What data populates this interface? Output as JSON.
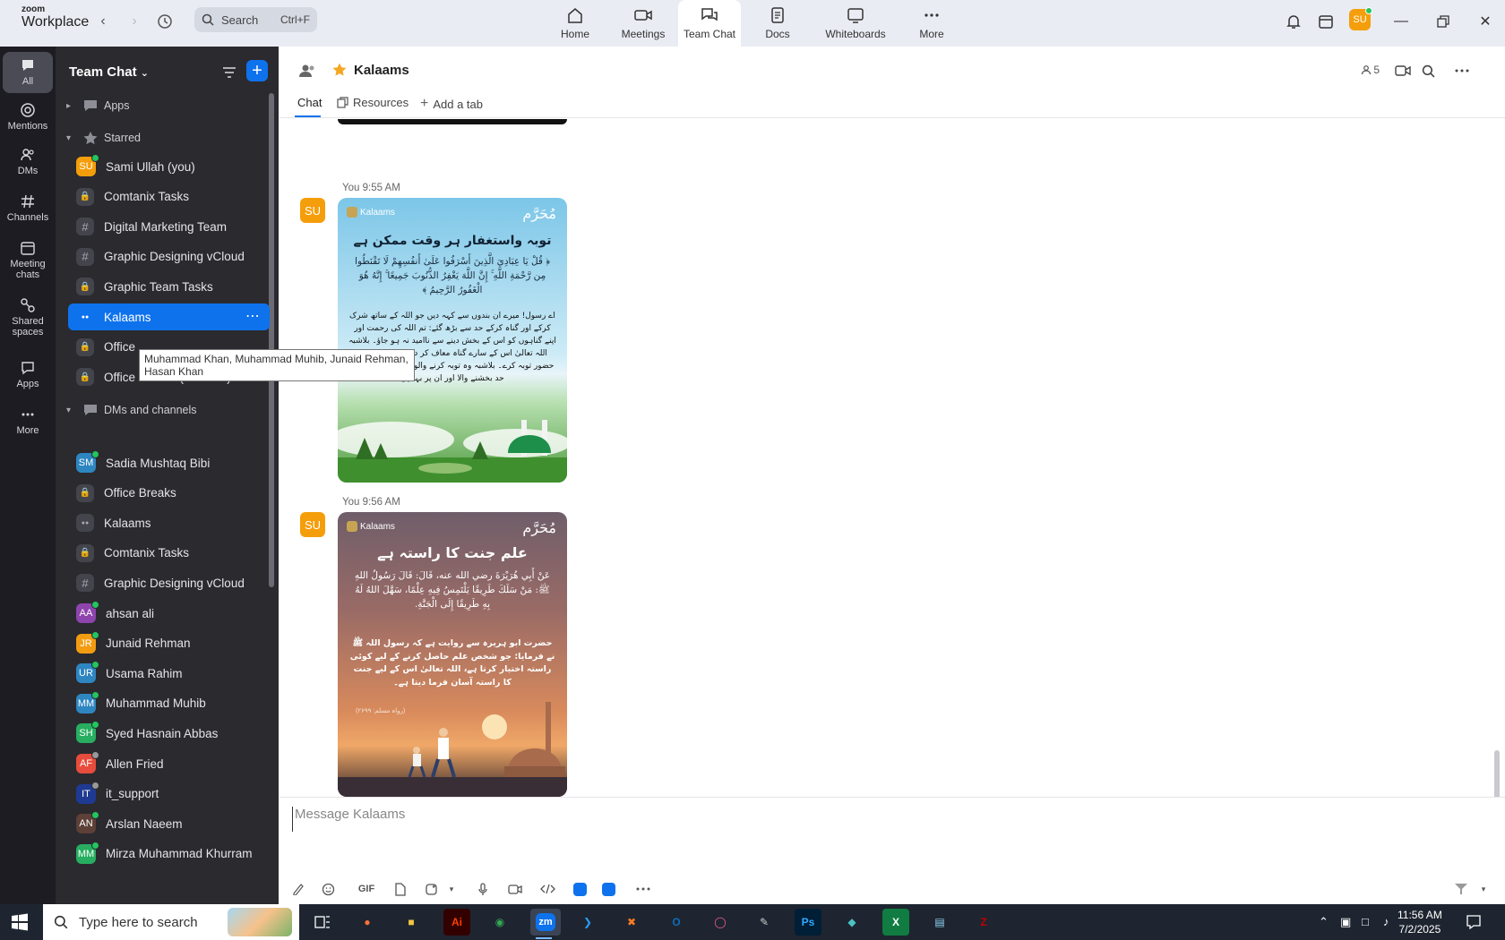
{
  "app": {
    "brand_top": "zoom",
    "brand_bottom": "Workplace"
  },
  "titlebar": {
    "search_placeholder": "Search",
    "search_shortcut": "Ctrl+F",
    "nav": [
      {
        "label": "Home",
        "icon": "home-icon"
      },
      {
        "label": "Meetings",
        "icon": "video-icon"
      },
      {
        "label": "Team Chat",
        "icon": "chat-icon",
        "active": true
      },
      {
        "label": "Docs",
        "icon": "doc-icon"
      },
      {
        "label": "Whiteboards",
        "icon": "whiteboard-icon"
      },
      {
        "label": "More",
        "icon": "more-icon"
      }
    ],
    "user_initials": "SU"
  },
  "rail": [
    {
      "label": "All",
      "icon": "chat-bubble-icon",
      "active": true
    },
    {
      "label": "Mentions",
      "icon": "at-icon"
    },
    {
      "label": "DMs",
      "icon": "people-icon"
    },
    {
      "label": "Channels",
      "icon": "hash-icon"
    },
    {
      "label": "Meeting chats",
      "icon": "calendar-icon"
    },
    {
      "label": "Shared spaces",
      "icon": "shared-icon"
    },
    {
      "label": "Apps",
      "icon": "apps-icon"
    },
    {
      "label": "More",
      "icon": "ellipsis-icon"
    }
  ],
  "sidebar": {
    "title": "Team Chat",
    "sections": {
      "apps": "Apps",
      "starred": "Starred",
      "dms": "DMs and channels"
    },
    "starred": [
      {
        "label": "Sami Ullah (you)",
        "kind": "avatar",
        "initials": "SU",
        "color": "#f59e0b",
        "status": "#22c55e"
      },
      {
        "label": "Comtanix Tasks",
        "kind": "lock"
      },
      {
        "label": "Digital Marketing Team",
        "kind": "hash"
      },
      {
        "label": "Graphic Designing vCloud",
        "kind": "hash"
      },
      {
        "label": "Graphic Team Tasks",
        "kind": "lock"
      },
      {
        "label": "Kalaams",
        "kind": "group",
        "active": true
      },
      {
        "label": "Office",
        "kind": "lock"
      },
      {
        "label": "Office Breaks (IT Team)",
        "kind": "lock",
        "trail": true
      }
    ],
    "dms": [
      {
        "label": "Sadia Mushtaq Bibi",
        "kind": "avatar",
        "initials": "SM",
        "color": "#2e86c1",
        "status": "#22c55e"
      },
      {
        "label": "Office Breaks",
        "kind": "lock"
      },
      {
        "label": "Kalaams",
        "kind": "group"
      },
      {
        "label": "Comtanix Tasks",
        "kind": "lock"
      },
      {
        "label": "Graphic Designing vCloud",
        "kind": "hash"
      },
      {
        "label": "ahsan ali",
        "kind": "avatar",
        "initials": "AA",
        "color": "#8e44ad",
        "status": "#22c55e"
      },
      {
        "label": "Junaid Rehman",
        "kind": "avatar",
        "initials": "JR",
        "color": "#f39c12",
        "status": "#22c55e"
      },
      {
        "label": "Usama Rahim",
        "kind": "avatar",
        "initials": "UR",
        "color": "#2e86c1",
        "status": "#22c55e"
      },
      {
        "label": "Muhammad Muhib",
        "kind": "avatar",
        "initials": "MM",
        "color": "#2e86c1",
        "status": "#22c55e"
      },
      {
        "label": "Syed Hasnain Abbas",
        "kind": "avatar",
        "initials": "SH",
        "color": "#27ae60",
        "status": "#22c55e"
      },
      {
        "label": "Allen Fried",
        "kind": "avatar",
        "initials": "AF",
        "color": "#e74c3c",
        "status": "#999999"
      },
      {
        "label": "it_support",
        "kind": "avatar",
        "initials": "IT",
        "color": "#1f3a93",
        "status": "#999999"
      },
      {
        "label": "Arslan Naeem",
        "kind": "avatar",
        "initials": "AN",
        "color": "#5d4037",
        "status": "#22c55e"
      },
      {
        "label": "Mirza Muhammad Khurram",
        "kind": "avatar",
        "initials": "MM",
        "color": "#27ae60",
        "status": "#22c55e"
      }
    ],
    "tooltip": "Muhammad Khan, Muhammad Muhib, Junaid Rehman, Hasan Khan"
  },
  "channel": {
    "title": "Kalaams",
    "member_count": "5",
    "tabs": {
      "chat": "Chat",
      "resources": "Resources",
      "add": "Add a tab"
    }
  },
  "messages": [
    {
      "sender_initials": "SU",
      "meta": "You 9:55 AM",
      "card": {
        "brand": "Kalaams",
        "badge": "مُحَرَّم",
        "heading": "توبہ واستغفار ہر وقت ممکن ہے",
        "arabic": "﴿ قُلْ يَا عِبَادِيَ الَّذِينَ أَسْرَفُوا عَلَىٰ أَنفُسِهِمْ لَا تَقْنَطُوا مِن رَّحْمَةِ اللَّهِ ۚ إِنَّ اللَّهَ يَغْفِرُ الذُّنُوبَ جَمِيعًا ۚ إِنَّهُ هُوَ الْغَفُورُ الرَّحِيمُ ﴾",
        "urdu": "اے رسول! میرے ان بندوں سے کہہ دیں جو اللہ کے ساتھ شرک کرکے اور گناہ کرکے حد سے بڑھ گئے: تم اللہ کی رحمت اور اپنے گناہوں کو اس کے بخش دینے سے ناامید نہ ہو جاؤ۔ بلاشبہ اللہ تعالیٰ اس کے سارے گناہ معاف کر دیتا ہے جو اس کے حضور توبہ کرے۔ بلاشبہ وہ توبہ کرنے والوں کے سارے گناہ بے حد بخشنے والا اور ان پر بہا ہے"
      }
    },
    {
      "sender_initials": "SU",
      "meta": "You 9:56 AM",
      "card": {
        "brand": "Kalaams",
        "badge": "مُحَرَّم",
        "heading": "علم جنت کا راستہ ہے",
        "arabic": "عَنْ أَبِي هُرَيْرَةَ رضي الله عنه، قَالَ: قَالَ رَسُولُ اللهِ ﷺ: مَنْ سَلَكَ طَرِيقًا يَلْتَمِسُ فِيهِ عِلْمًا، سَهَّلَ اللهُ لَهُ بِهِ طَرِيقًا إِلَى الْجَنَّةِ.",
        "urdu": "حضرت ابو ہریرہ سے روایت ہے کہ رسول اللہ ﷺ نے فرمایا: جو شخص علم حاصل کرنے کے لیے کوئی راستہ اختیار کرتا ہے، اللہ تعالیٰ اس کے لیے جنت کا راستہ آسان فرما دیتا ہے۔",
        "ref": "(رواہ مسلم: ۲۶۹۹)"
      }
    }
  ],
  "composer": {
    "placeholder": "Message Kalaams",
    "gif_label": "GIF"
  },
  "taskbar": {
    "search_placeholder": "Type here to search",
    "time": "11:56 AM",
    "date": "7/2/2025",
    "apps": [
      "firefox",
      "file-explorer",
      "illustrator",
      "chrome",
      "zoom",
      "vscode",
      "xampp",
      "outlook",
      "creative-cloud",
      "pen-tool",
      "photoshop",
      "app",
      "excel",
      "notepad",
      "filezilla"
    ]
  }
}
